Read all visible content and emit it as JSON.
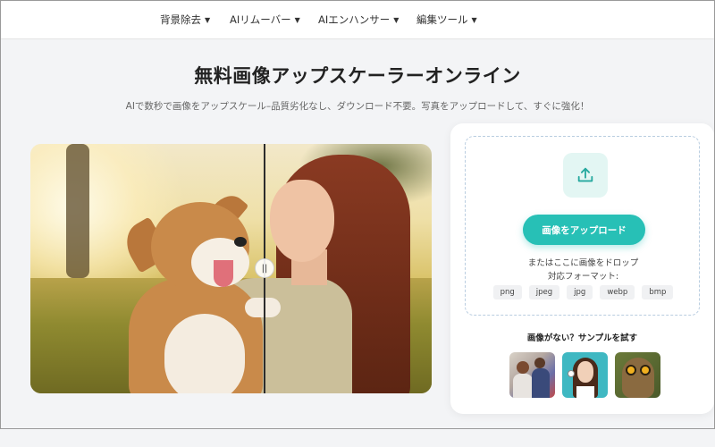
{
  "nav": {
    "items": [
      {
        "label": "背景除去",
        "caret": "▼"
      },
      {
        "label": "AIリムーバー",
        "caret": "▼"
      },
      {
        "label": "AIエンハンサー",
        "caret": "▼"
      },
      {
        "label": "編集ツール",
        "caret": "▼"
      }
    ]
  },
  "hero": {
    "title": "無料画像アップスケーラーオンライン",
    "subtitle": "AIで数秒で画像をアップスケール–品質劣化なし、ダウンロード不要。写真をアップロードして、すぐに強化！"
  },
  "compare": {
    "handle_icon": "drag-handle-icon",
    "handle_glyph": "||"
  },
  "upload": {
    "icon": "upload-icon",
    "button_label": "画像をアップロード",
    "drop_text": "またはここに画像をドロップ",
    "formats_label": "対応フォーマット:",
    "formats": [
      "png",
      "jpeg",
      "jpg",
      "webp",
      "bmp"
    ],
    "accent_color": "#27c0b6"
  },
  "samples": {
    "title": "画像がない？サンプルを試す"
  }
}
